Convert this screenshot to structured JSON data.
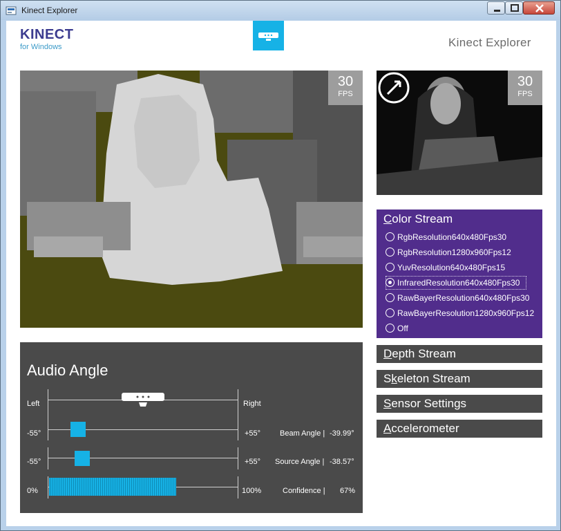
{
  "window": {
    "title": "Kinect Explorer",
    "controls": {
      "minimize": "minimize-icon",
      "maximize": "maximize-icon",
      "close": "close-icon"
    }
  },
  "header": {
    "logo_main": "KINECT",
    "logo_sub": "for Windows",
    "app_title": "Kinect Explorer",
    "sensor_icon": "kinect-sensor-icon"
  },
  "depth_view": {
    "fps_value": "30",
    "fps_label": "FPS"
  },
  "ir_view": {
    "fps_value": "30",
    "fps_label": "FPS",
    "swap_icon": "swap-arrows-icon"
  },
  "audio": {
    "title": "Audio Angle",
    "left_label": "Left",
    "right_label": "Right",
    "beam": {
      "min": "-55°",
      "max": "+55°",
      "label": "Beam Angle |",
      "value": "-39.99°",
      "position_fraction": 0.16
    },
    "source": {
      "min": "-55°",
      "max": "+55°",
      "label": "Source Angle |",
      "value": "-38.57°",
      "position_fraction": 0.18
    },
    "confidence": {
      "min": "0%",
      "max": "100%",
      "label": "Confidence |",
      "value": "67%",
      "fraction": 0.67
    }
  },
  "color_stream": {
    "heading_key": "C",
    "heading_rest": "olor Stream",
    "options": [
      {
        "label": "RgbResolution640x480Fps30",
        "selected": false
      },
      {
        "label": "RgbResolution1280x960Fps12",
        "selected": false
      },
      {
        "label": "YuvResolution640x480Fps15",
        "selected": false
      },
      {
        "label": "InfraredResolution640x480Fps30",
        "selected": true
      },
      {
        "label": "RawBayerResolution640x480Fps30",
        "selected": false
      },
      {
        "label": "RawBayerResolution1280x960Fps12",
        "selected": false
      },
      {
        "label": "Off",
        "selected": false
      }
    ]
  },
  "panels": {
    "depth": {
      "key": "D",
      "rest": "epth Stream"
    },
    "skeleton": {
      "pre": "S",
      "key": "k",
      "rest": "eleton Stream"
    },
    "sensor": {
      "key": "S",
      "rest": "ensor Settings"
    },
    "accel": {
      "key": "A",
      "rest": "ccelerometer"
    }
  },
  "colors": {
    "accent": "#16b2e6",
    "purple_panel": "#512d8c",
    "dark_panel": "#4a4a4a",
    "depth_bg": "#4b4a10"
  }
}
